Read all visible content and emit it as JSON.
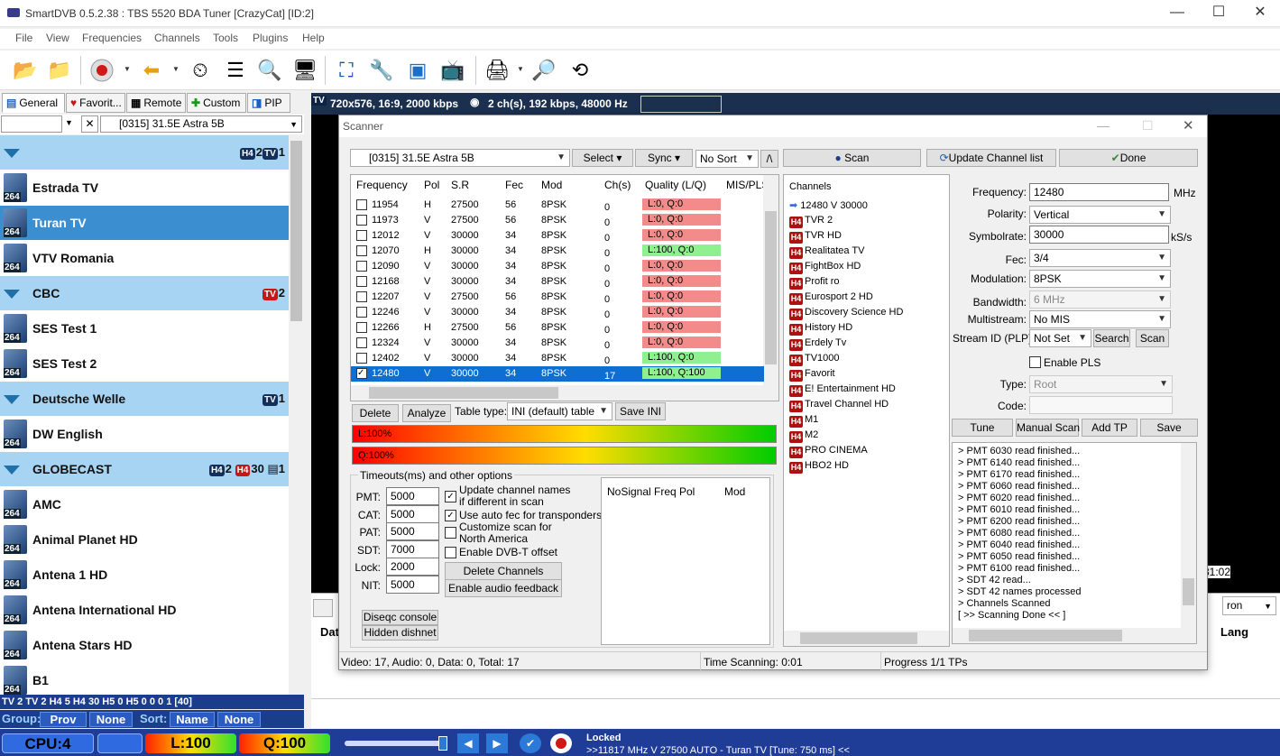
{
  "window": {
    "title": "SmartDVB 0.5.2.38 : TBS 5520 BDA Tuner [CrazyCat] [ID:2]",
    "minimize": "—",
    "maximize": "☐",
    "close": "✕"
  },
  "menu": [
    "File",
    "View",
    "Frequencies",
    "Channels",
    "Tools",
    "Plugins",
    "Help"
  ],
  "sidebar": {
    "tabs": [
      "General",
      "Favorit...",
      "Remote",
      "Custom",
      "PIP"
    ],
    "satellite": "[0315] 31.5E  Astra 5B",
    "items": [
      {
        "type": "group",
        "label": "",
        "badges": "2 1"
      },
      {
        "type": "channel",
        "label": "Estrada TV"
      },
      {
        "type": "channel",
        "label": "Turan TV"
      },
      {
        "type": "channel",
        "label": "VTV Romania"
      },
      {
        "type": "group",
        "label": "CBC",
        "badges": "2"
      },
      {
        "type": "channel",
        "label": "SES Test 1"
      },
      {
        "type": "channel",
        "label": "SES Test 2"
      },
      {
        "type": "group",
        "label": "Deutsche Welle",
        "badges": "1"
      },
      {
        "type": "channel",
        "label": "DW English"
      },
      {
        "type": "group",
        "label": "GLOBECAST",
        "badges": "2  30  1"
      },
      {
        "type": "channel",
        "label": "AMC"
      },
      {
        "type": "channel",
        "label": "Animal Planet HD"
      },
      {
        "type": "channel",
        "label": "Antena 1 HD"
      },
      {
        "type": "channel",
        "label": "Antena International HD"
      },
      {
        "type": "channel",
        "label": "Antena Stars HD"
      },
      {
        "type": "channel",
        "label": "B1"
      }
    ],
    "counts": "TV 2  TV 2  H4 5  H4 30  H5 0  H5 0   0   0   1  [40]",
    "group_label": "Group:",
    "group_value": "Prov",
    "group_none": "None",
    "sort_label": "Sort:",
    "sort_value": "Name",
    "sort_none": "None"
  },
  "video": {
    "info": "720x576, 16:9, 2000 kbps",
    "audio": "2 ch(s), 192 kbps, 48000 Hz",
    "time": "31:02",
    "combo": "ron",
    "date_header": "Dat",
    "lang_header": "Lang"
  },
  "scanner": {
    "title": "Scanner",
    "satellite": "[0315]  31.5E  Astra 5B",
    "select": "Select",
    "sync": "Sync",
    "sort": "No Sort",
    "slash": "/\\",
    "scan": "Scan",
    "update": "Update Channel list",
    "done": "Done",
    "table_headers": [
      "Frequency",
      "Pol",
      "S.R",
      "Fec",
      "Mod",
      "Ch(s)",
      "Quality (L/Q)",
      "MIS/PLS"
    ],
    "rows": [
      {
        "freq": "11954",
        "pol": "H",
        "sr": "27500",
        "fec": "56",
        "mod": "8PSK",
        "ch": "0",
        "q": "L:0, Q:0",
        "ok": false
      },
      {
        "freq": "11973",
        "pol": "V",
        "sr": "27500",
        "fec": "56",
        "mod": "8PSK",
        "ch": "0",
        "q": "L:0, Q:0",
        "ok": false
      },
      {
        "freq": "12012",
        "pol": "V",
        "sr": "30000",
        "fec": "34",
        "mod": "8PSK",
        "ch": "0",
        "q": "L:0, Q:0",
        "ok": false
      },
      {
        "freq": "12070",
        "pol": "H",
        "sr": "30000",
        "fec": "34",
        "mod": "8PSK",
        "ch": "0",
        "q": "L:100, Q:0",
        "ok": true
      },
      {
        "freq": "12090",
        "pol": "V",
        "sr": "30000",
        "fec": "34",
        "mod": "8PSK",
        "ch": "0",
        "q": "L:0, Q:0",
        "ok": false
      },
      {
        "freq": "12168",
        "pol": "V",
        "sr": "30000",
        "fec": "34",
        "mod": "8PSK",
        "ch": "0",
        "q": "L:0, Q:0",
        "ok": false
      },
      {
        "freq": "12207",
        "pol": "V",
        "sr": "27500",
        "fec": "56",
        "mod": "8PSK",
        "ch": "0",
        "q": "L:0, Q:0",
        "ok": false
      },
      {
        "freq": "12246",
        "pol": "V",
        "sr": "30000",
        "fec": "34",
        "mod": "8PSK",
        "ch": "0",
        "q": "L:0, Q:0",
        "ok": false
      },
      {
        "freq": "12266",
        "pol": "H",
        "sr": "27500",
        "fec": "56",
        "mod": "8PSK",
        "ch": "0",
        "q": "L:0, Q:0",
        "ok": false
      },
      {
        "freq": "12324",
        "pol": "V",
        "sr": "30000",
        "fec": "34",
        "mod": "8PSK",
        "ch": "0",
        "q": "L:0, Q:0",
        "ok": false
      },
      {
        "freq": "12402",
        "pol": "V",
        "sr": "30000",
        "fec": "34",
        "mod": "8PSK",
        "ch": "0",
        "q": "L:100, Q:0",
        "ok": true
      },
      {
        "freq": "12480",
        "pol": "V",
        "sr": "30000",
        "fec": "34",
        "mod": "8PSK",
        "ch": "17",
        "q": "L:100, Q:100",
        "ok": true,
        "selected": true
      }
    ],
    "delete": "Delete",
    "analyze": "Analyze",
    "table_type_label": "Table type:",
    "table_type": "INI (default) table",
    "save_ini": "Save INI",
    "level": "L:100%",
    "quality": "Q:100%",
    "level_pct": 100,
    "quality_pct": 100,
    "timeouts_title": "Timeouts(ms) and other options",
    "timeouts": [
      {
        "label": "PMT:",
        "value": "5000"
      },
      {
        "label": "CAT:",
        "value": "5000"
      },
      {
        "label": "PAT:",
        "value": "5000"
      },
      {
        "label": "SDT:",
        "value": "7000"
      },
      {
        "label": "Lock:",
        "value": "2000"
      },
      {
        "label": "NIT:",
        "value": "5000"
      }
    ],
    "options": [
      {
        "label": "Update channel names if different in scan",
        "checked": true
      },
      {
        "label": "Use auto fec for transponders",
        "checked": true
      },
      {
        "label": "Customize scan for North America",
        "checked": false
      },
      {
        "label": "Enable DVB-T offset",
        "checked": false
      }
    ],
    "delete_channels": "Delete Channels",
    "enable_audio": "Enable audio feedback",
    "diseqc": "Diseqc console",
    "hidden": "Hidden dishnet",
    "nosig_headers": [
      "NoSignal Freq",
      "Pol",
      "Mod"
    ],
    "channels_title": "Channels",
    "tp_node": "12480 V 30000",
    "channels": [
      "TVR 2",
      "TVR HD",
      "Realitatea TV",
      "FightBox HD",
      "Profit ro",
      "Eurosport 2 HD",
      "Discovery Science HD",
      "History HD",
      "Erdely Tv",
      "TV1000",
      "Favorit",
      "E! Entertainment HD",
      "Travel Channel HD",
      "M1",
      "M2",
      "PRO CINEMA",
      "HBO2 HD"
    ],
    "params": {
      "frequency_label": "Frequency:",
      "frequency": "12480",
      "mhz": "MHz",
      "polarity_label": "Polarity:",
      "polarity": "Vertical",
      "symbolrate_label": "Symbolrate:",
      "symbolrate": "30000",
      "ks": "kS/s",
      "fec_label": "Fec:",
      "fec": "3/4",
      "modulation_label": "Modulation:",
      "modulation": "8PSK",
      "bandwidth_label": "Bandwidth:",
      "bandwidth": "6 MHz",
      "multistream_label": "Multistream:",
      "multistream": "No MIS",
      "streamid_label": "Stream ID (PLP):",
      "streamid": "Not Set",
      "search": "Search",
      "scan": "Scan",
      "enable_pls": "Enable PLS",
      "type_label": "Type:",
      "type": "Root",
      "code_label": "Code:"
    },
    "tune": "Tune",
    "manual_scan": "Manual Scan",
    "add_tp": "Add TP",
    "save": "Save",
    "log": [
      ">    PMT 6030 read finished...",
      ">    PMT 6140 read finished...",
      ">    PMT 6170 read finished...",
      ">    PMT 6060 read finished...",
      ">    PMT 6020 read finished...",
      ">    PMT 6010 read finished...",
      ">    PMT 6200 read finished...",
      ">    PMT 6080 read finished...",
      ">    PMT 6040 read finished...",
      ">    PMT 6050 read finished...",
      ">    PMT 6100 read finished...",
      ">    SDT 42 read...",
      ">    SDT 42 names processed",
      ">    Channels Scanned",
      "[  >> Scanning Done << ]"
    ],
    "status_counts": "Video: 17, Audio: 0, Data: 0, Total: 17",
    "status_time": "Time Scanning: 0:01",
    "status_progress": "Progress 1/1 TPs"
  },
  "status": {
    "cpu": "CPU:4",
    "level": "L:100",
    "quality": "Q:100",
    "locked": "Locked",
    "info": ">>11817 MHz V 27500 AUTO - Turan TV [Tune: 750 ms] <<"
  },
  "colors": {
    "accent": "#1f3c97",
    "bad": "#f48b8b",
    "good": "#8ef08e",
    "selected": "#0d6fd1"
  }
}
